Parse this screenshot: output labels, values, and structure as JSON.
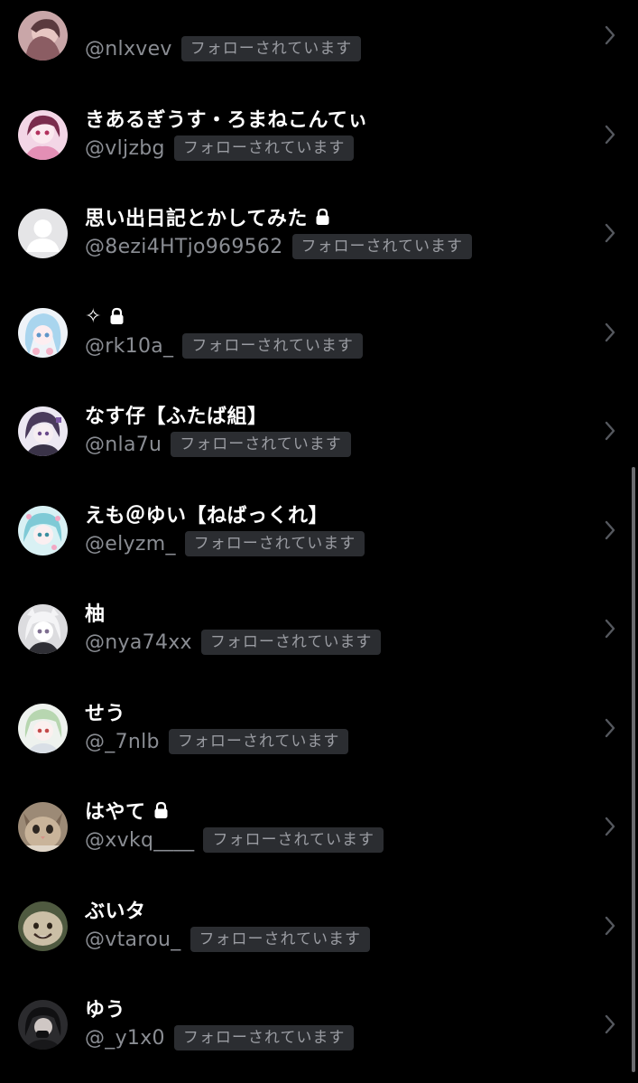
{
  "follows_badge": "フォローされています",
  "colors": {
    "background": "#000000",
    "name": "#ffffff",
    "handle": "#8a8d93",
    "badge_bg": "#2b2d31",
    "badge_text": "#9a9ca2"
  },
  "users": [
    {
      "name": "",
      "handle": "@nlxvev",
      "locked": false,
      "avatar": "pink-photo"
    },
    {
      "name": "きあるぎうす・ろまねこんてぃ",
      "handle": "@vljzbg",
      "locked": false,
      "avatar": "anime-pink"
    },
    {
      "name": "思い出日記とかしてみた",
      "handle": "@8ezi4HTjo969562",
      "locked": true,
      "avatar": "default-person"
    },
    {
      "name": "✧",
      "handle": "@rk10a_",
      "locked": true,
      "avatar": "anime-lightblue"
    },
    {
      "name": "なす仔【ふたば組】",
      "handle": "@nla7u",
      "locked": false,
      "avatar": "anime-purple"
    },
    {
      "name": "えも＠ゆい【ねばっくれ】",
      "handle": "@elyzm_",
      "locked": false,
      "avatar": "anime-cyan"
    },
    {
      "name": "柚",
      "handle": "@nya74xx",
      "locked": false,
      "avatar": "anime-white"
    },
    {
      "name": "せう",
      "handle": "@_7nlb",
      "locked": false,
      "avatar": "anime-green"
    },
    {
      "name": "はやて",
      "handle": "@xvkq____",
      "locked": true,
      "avatar": "cat-photo"
    },
    {
      "name": "ぶいタ",
      "handle": "@vtarou_",
      "locked": false,
      "avatar": "cat-photo-2"
    },
    {
      "name": "ゆう",
      "handle": "@_y1x0",
      "locked": false,
      "avatar": "dark-photo"
    }
  ]
}
